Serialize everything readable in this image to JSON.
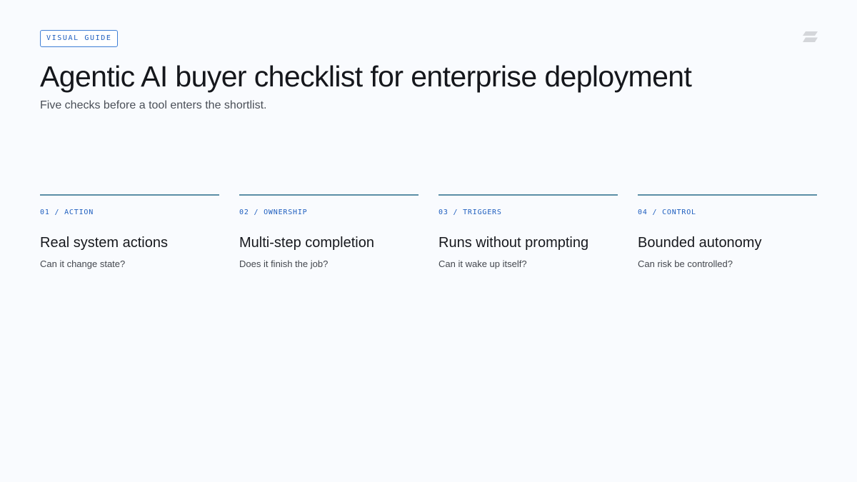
{
  "header": {
    "badge": "VISUAL GUIDE",
    "title": "Agentic AI buyer checklist for enterprise deployment",
    "subtitle": "Five checks before a tool enters the shortlist."
  },
  "logo": {
    "icon": "stacked-parallelogram-logo-icon",
    "color": "#d4d6da"
  },
  "colors": {
    "accent": "#1f5fbf",
    "divider": "#5b8fa6",
    "background": "#f9fbfe"
  },
  "cards": [
    {
      "tag": "01 / ACTION",
      "title": "Real system actions",
      "question": "Can it change state?"
    },
    {
      "tag": "02 / OWNERSHIP",
      "title": "Multi-step completion",
      "question": "Does it finish the job?"
    },
    {
      "tag": "03 / TRIGGERS",
      "title": "Runs without prompting",
      "question": "Can it wake up itself?"
    },
    {
      "tag": "04 / CONTROL",
      "title": "Bounded autonomy",
      "question": "Can risk be controlled?"
    }
  ]
}
